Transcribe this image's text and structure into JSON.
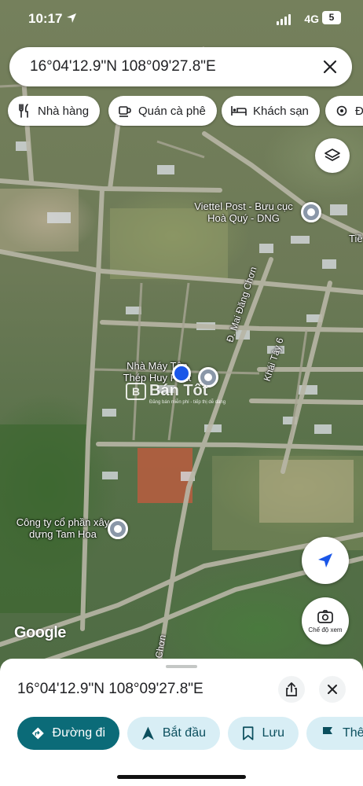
{
  "status_bar": {
    "time": "10:17",
    "network": "4G",
    "battery": "5"
  },
  "search": {
    "query": "16°04'12.9\"N 108°09'27.8\"E"
  },
  "chips": [
    {
      "label": "Nhà hàng",
      "icon": "fork-knife-icon"
    },
    {
      "label": "Quán cà phê",
      "icon": "coffee-cup-icon"
    },
    {
      "label": "Khách sạn",
      "icon": "bed-icon"
    },
    {
      "label": "Đị",
      "icon": "gear-icon"
    }
  ],
  "map": {
    "places": [
      {
        "name": "Viettel Post - Bưu cục Hoà Quý - DNG"
      },
      {
        "name": "Nhà Máy Tôn Thép Huy Phát"
      },
      {
        "name": "Công ty cổ phần xây dựng Tam Hoa"
      }
    ],
    "street_labels": [
      "Đ. Mai Đăng Chơn",
      "Khái Tây 6",
      "Chơn",
      "Tiề"
    ],
    "watermark": "Bán Tốt",
    "watermark_sub": "Đăng bán miễn phí - tiếp thị dễ dàng",
    "attribution": "Google",
    "street_view_label": "Chế độ xem"
  },
  "sheet": {
    "coordinates": "16°04'12.9\"N 108°09'27.8\"E",
    "actions": [
      {
        "label": "Đường đi",
        "icon": "directions-icon",
        "style": "primary"
      },
      {
        "label": "Bắt đầu",
        "icon": "navigation-arrow-icon",
        "style": "secondary"
      },
      {
        "label": "Lưu",
        "icon": "bookmark-icon",
        "style": "secondary"
      },
      {
        "label": "Thê",
        "icon": "flag-icon",
        "style": "secondary"
      }
    ]
  },
  "colors": {
    "primary_action": "#0b6b78",
    "secondary_action": "#d8eef5",
    "location_dot": "#1a56e8"
  }
}
